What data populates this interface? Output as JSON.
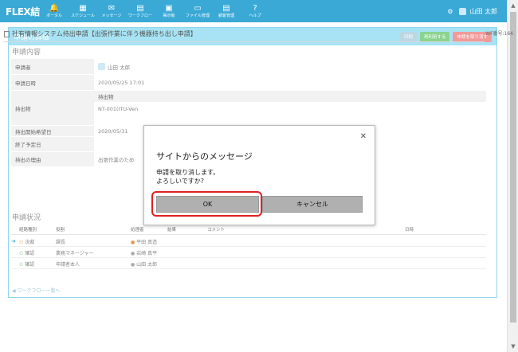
{
  "app": {
    "logo": "FLEX結"
  },
  "nav": {
    "items": [
      {
        "icon": "🔔",
        "label": "ポータル"
      },
      {
        "icon": "▦",
        "label": "スケジュール"
      },
      {
        "icon": "✉",
        "label": "メッセージ"
      },
      {
        "icon": "▤",
        "label": "ワークフロー"
      },
      {
        "icon": "▣",
        "label": "掲示板"
      },
      {
        "icon": "▭",
        "label": "ファイル管理"
      },
      {
        "icon": "▤",
        "label": "顧客管理"
      },
      {
        "icon": "?",
        "label": "ヘルプ"
      }
    ],
    "settings_icon": "⚙",
    "user_name": "山田 太郎"
  },
  "panel": {
    "title": "申請の詳細",
    "buttons": {
      "print": "印刷",
      "reuse": "再利用する",
      "cancel": "申請を取り消す"
    },
    "doc_title": "社有情報システム持出申請【出張作業に伴う機器持ち出し申請】",
    "wf_no": "WF番号:164"
  },
  "content": {
    "section_title": "申請内容",
    "rows": {
      "applicant": {
        "label": "申請者",
        "value": "山田 太郎"
      },
      "date": {
        "label": "申請日時",
        "value": "2020/05/25 17:01"
      },
      "item": {
        "label": "持出物",
        "sub_label": "持出物",
        "value": "NT-001(ITU-Ven"
      },
      "start": {
        "label": "持出開始希望日",
        "value": "2020/05/31"
      },
      "end": {
        "label": "終了予定日",
        "value": ""
      },
      "reason": {
        "label": "持出の理由",
        "value": "出張作業のため"
      }
    }
  },
  "status": {
    "section_title": "申請状況",
    "headers": {
      "type": "経路種別",
      "role": "役割",
      "approver": "処理者",
      "result": "結果",
      "comment": "コメント",
      "datetime": "日時"
    },
    "rows": [
      {
        "type": "決裁",
        "role": "課長",
        "approver": "平田 真造"
      },
      {
        "type": "確認",
        "role": "業務マネージャー",
        "approver": "岩崎 真平"
      },
      {
        "type": "確認",
        "role": "申請者本人",
        "approver": "山田 太郎"
      }
    ],
    "back_link": "ワークフロー一覧へ"
  },
  "dialog": {
    "title": "サイトからのメッセージ",
    "message_line1": "申請を取り消します。",
    "message_line2": "よろしいですか?",
    "ok_label": "OK",
    "cancel_label": "キャンセル",
    "close_icon": "✕"
  }
}
